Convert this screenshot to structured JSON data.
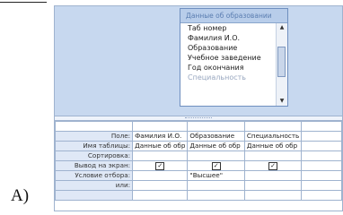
{
  "page": {
    "option_label": "A)"
  },
  "field_list": {
    "title": "Данные об образовании",
    "items": [
      "Таб номер",
      "Фамилия И.О.",
      "Образование",
      "Учебное заведение",
      "Год окончания",
      "Специальность"
    ]
  },
  "grid": {
    "row_labels": [
      "Поле:",
      "Имя таблицы:",
      "Сортировка:",
      "Вывод на экран:",
      "Условие отбора:",
      "или:"
    ],
    "columns": [
      {
        "field": "Фамилия И.О.",
        "table": "Данные об обр",
        "show": true,
        "criteria": ""
      },
      {
        "field": "Образование",
        "table": "Данные об обр",
        "show": true,
        "criteria": "\"Высшее\""
      },
      {
        "field": "Специальность",
        "table": "Данные об обр",
        "show": true,
        "criteria": ""
      }
    ]
  }
}
